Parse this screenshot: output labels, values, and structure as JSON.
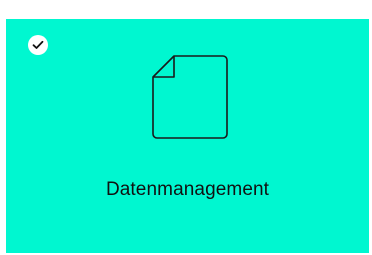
{
  "card": {
    "label": "Datenmanagement",
    "selected": true,
    "background_color": "#00f7d0",
    "icon": "document-icon",
    "status_icon": "checkmark-icon"
  }
}
